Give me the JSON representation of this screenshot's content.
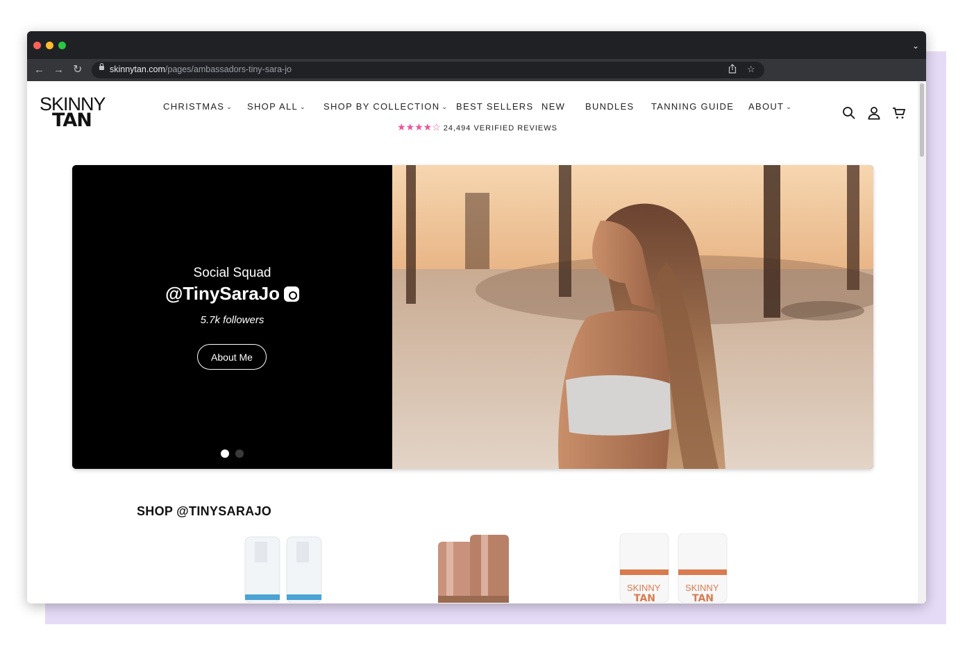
{
  "browser": {
    "url_domain": "skinnytan.com",
    "url_path": "/pages/ambassadors-tiny-sara-jo",
    "traffic_colors": [
      "#ff5f57",
      "#febc2e",
      "#28c840"
    ]
  },
  "header": {
    "logo_line1": "SKINNY",
    "logo_line2": "TAN",
    "nav": [
      {
        "label": "CHRISTMAS",
        "dropdown": true
      },
      {
        "label": "SHOP ALL",
        "dropdown": true
      },
      {
        "label": "SHOP BY COLLECTION",
        "dropdown": true
      },
      {
        "label": "BEST SELLERS",
        "dropdown": false
      },
      {
        "label": "NEW",
        "dropdown": false
      },
      {
        "label": "BUNDLES",
        "dropdown": false
      },
      {
        "label": "TANNING GUIDE",
        "dropdown": false
      },
      {
        "label": "ABOUT",
        "dropdown": true
      }
    ],
    "reviews_rating": 4.5,
    "reviews_text": "24,494 VERIFIED REVIEWS",
    "icons": [
      "search-icon",
      "account-icon",
      "cart-icon"
    ]
  },
  "hero": {
    "subtitle": "Social Squad",
    "handle": "@TinySaraJo",
    "followers": "5.7k followers",
    "button_label": "About Me",
    "slides": 2,
    "active_slide": 1
  },
  "shop": {
    "title": "SHOP @TINYSARAJO",
    "product_logo_line1": "SKINNY",
    "product_logo_line2": "TAN"
  },
  "colors": {
    "accent_pink": "#ec5597",
    "hero_bg": "#000000",
    "backdrop": "#e6dbf7"
  }
}
